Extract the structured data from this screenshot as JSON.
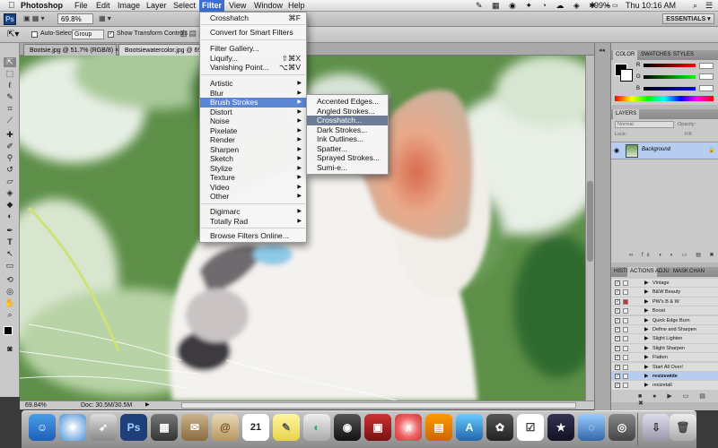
{
  "menubar": {
    "app_name": "Photoshop",
    "items": [
      "File",
      "Edit",
      "Image",
      "Layer",
      "Select",
      "Filter",
      "View",
      "Window",
      "Help"
    ],
    "status": {
      "battery": "99%",
      "clock": "Thu 10:16 AM"
    }
  },
  "appbar": {
    "badge": "Ps",
    "zoom": "69.8%",
    "workspace": "ESSENTIALS ▾"
  },
  "options": {
    "auto_select_label": "Auto-Select:",
    "auto_select_value": "Group",
    "transform_label": "Show Transform Controls"
  },
  "doc_tabs": [
    {
      "label": "Bootsie.jpg @ 51.7% (RGB/8) ×"
    },
    {
      "label": "Bootsiewatercolor.jpg @ 69.8% (RGB/8) ×"
    }
  ],
  "status": {
    "zoom": "69.84%",
    "doc": "Doc: 30.5M/30.5M"
  },
  "filter_menu": {
    "items": [
      {
        "label": "Crosshatch",
        "shortcut": "⌘F"
      },
      {
        "label": "Convert for Smart Filters"
      },
      {
        "label": "Filter Gallery..."
      },
      {
        "label": "Liquify...",
        "shortcut": "⇧⌘X"
      },
      {
        "label": "Vanishing Point...",
        "shortcut": "⌥⌘V"
      },
      {
        "label": "Artistic"
      },
      {
        "label": "Blur"
      },
      {
        "label": "Brush Strokes"
      },
      {
        "label": "Distort"
      },
      {
        "label": "Noise"
      },
      {
        "label": "Pixelate"
      },
      {
        "label": "Render"
      },
      {
        "label": "Sharpen"
      },
      {
        "label": "Sketch"
      },
      {
        "label": "Stylize"
      },
      {
        "label": "Texture"
      },
      {
        "label": "Video"
      },
      {
        "label": "Other"
      },
      {
        "label": "Digimarc"
      },
      {
        "label": "Totally Rad"
      },
      {
        "label": "Browse Filters Online..."
      }
    ]
  },
  "brush_strokes_menu": {
    "items": [
      "Accented Edges...",
      "Angled Strokes...",
      "Crosshatch...",
      "Dark Strokes...",
      "Ink Outlines...",
      "Spatter...",
      "Sprayed Strokes...",
      "Sumi-e..."
    ]
  },
  "color_panel": {
    "tabs": [
      "COLOR",
      "SWATCHES",
      "STYLES"
    ],
    "sliders": [
      "R",
      "G",
      "B"
    ]
  },
  "layers_panel": {
    "title": "LAYERS",
    "blend": "Normal",
    "opacity_label": "Opacity:",
    "lock_label": "Lock:",
    "fill_label": "Fill:",
    "layer_name": "Background"
  },
  "actions_panel": {
    "tabs": [
      "HISTO",
      "ACTIONS",
      "ADJU",
      "MASK",
      "CHAN"
    ],
    "items": [
      "Vintage",
      "B&W Beauty",
      "PW's B & W",
      "Boost",
      "Quick Edge Burn",
      "Define and Sharpen",
      "Slight Lighten",
      "Slight Sharpen",
      "Flatten",
      "Start All Over!",
      "resizewide",
      "resizetall"
    ],
    "selected_index": 10
  },
  "dock": {
    "calendar_day": "21"
  }
}
